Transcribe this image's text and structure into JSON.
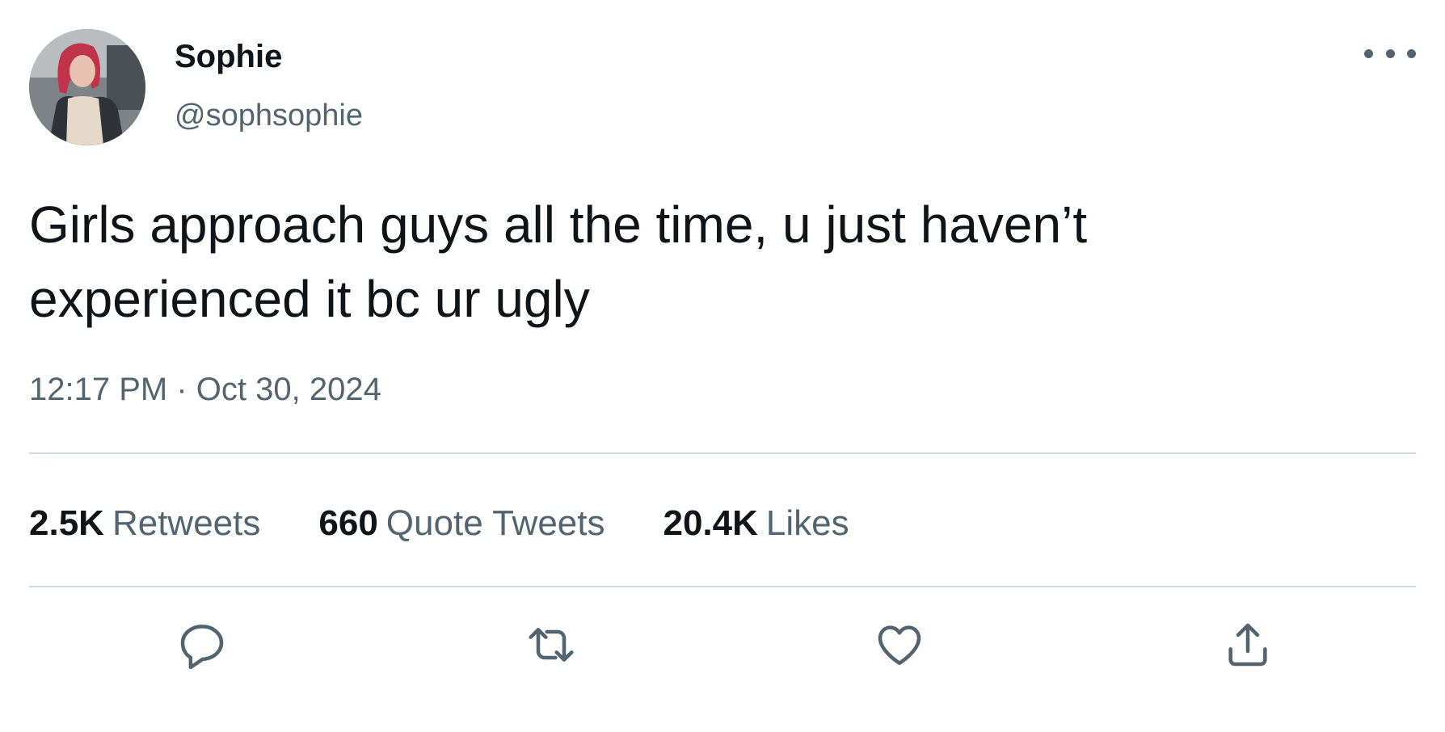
{
  "author": {
    "display_name": "Sophie",
    "handle": "@sophsophie",
    "avatar_icon": "profile-photo"
  },
  "tweet": {
    "text": "Girls approach guys all the time, u just haven’t experienced it bc ur ugly",
    "time": "12:17 PM",
    "separator": "·",
    "date": "Oct 30, 2024"
  },
  "stats": {
    "retweets": {
      "count": "2.5K",
      "label": "Retweets"
    },
    "quotes": {
      "count": "660",
      "label": "Quote Tweets"
    },
    "likes": {
      "count": "20.4K",
      "label": "Likes"
    }
  },
  "actions": {
    "reply_icon": "reply-icon",
    "retweet_icon": "retweet-icon",
    "like_icon": "like-icon",
    "share_icon": "share-icon"
  },
  "colors": {
    "primary_text": "#0f1419",
    "secondary_text": "#536471",
    "divider": "#cfd9de"
  }
}
